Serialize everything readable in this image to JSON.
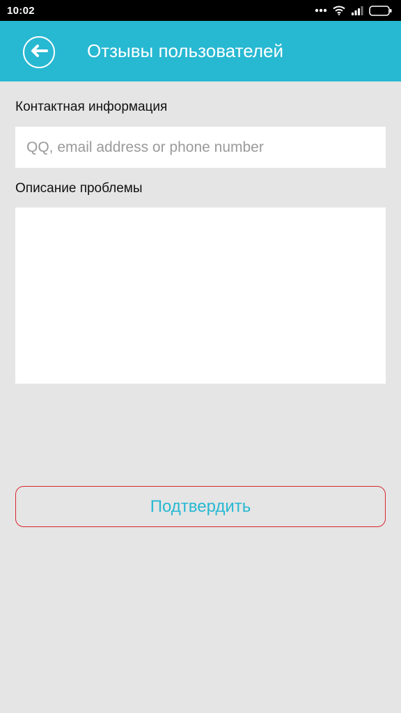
{
  "status_bar": {
    "time": "10:02"
  },
  "header": {
    "title": "Отзывы пользователей"
  },
  "form": {
    "contact_label": "Контактная информация",
    "contact_placeholder": "QQ, email address or phone number",
    "contact_value": "",
    "problem_label": "Описание проблемы",
    "problem_value": "",
    "submit_label": "Подтвердить"
  },
  "colors": {
    "primary": "#27b8d2",
    "background": "#e5e5e5",
    "button_border": "#d6262d"
  },
  "icons": {
    "back": "arrow-left-circle-icon",
    "signal": "signal-icon",
    "wifi": "wifi-icon",
    "battery": "battery-icon",
    "more": "more-dots-icon"
  }
}
